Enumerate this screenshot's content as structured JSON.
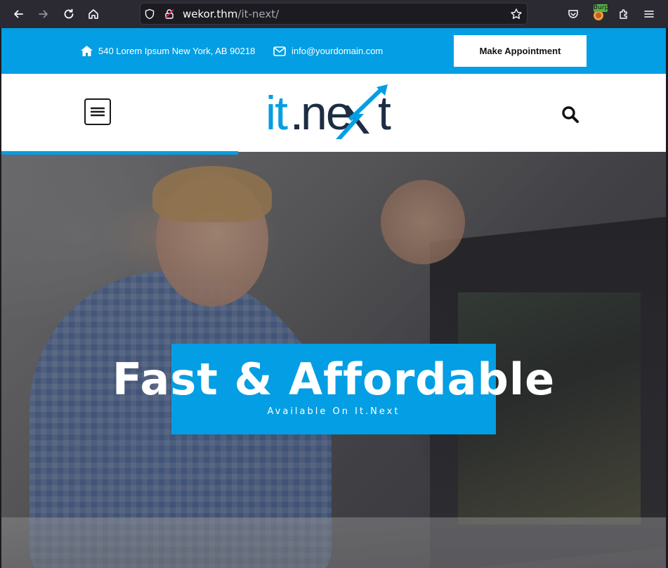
{
  "browser": {
    "url_host": "wekor.thm",
    "url_path": "/it-next/",
    "extension_badge": "Burp"
  },
  "topbar": {
    "address": "540 Lorem Ipsum New York, AB 90218",
    "email": "info@yourdomain.com",
    "appointment_label": "Make Appointment"
  },
  "logo": {
    "text": "it.next"
  },
  "hero": {
    "title": "Fast & Affordable",
    "subtitle": "Available On It.Next"
  },
  "colors": {
    "brand_blue": "#039ee3",
    "logo_dark": "#1d2d44"
  }
}
